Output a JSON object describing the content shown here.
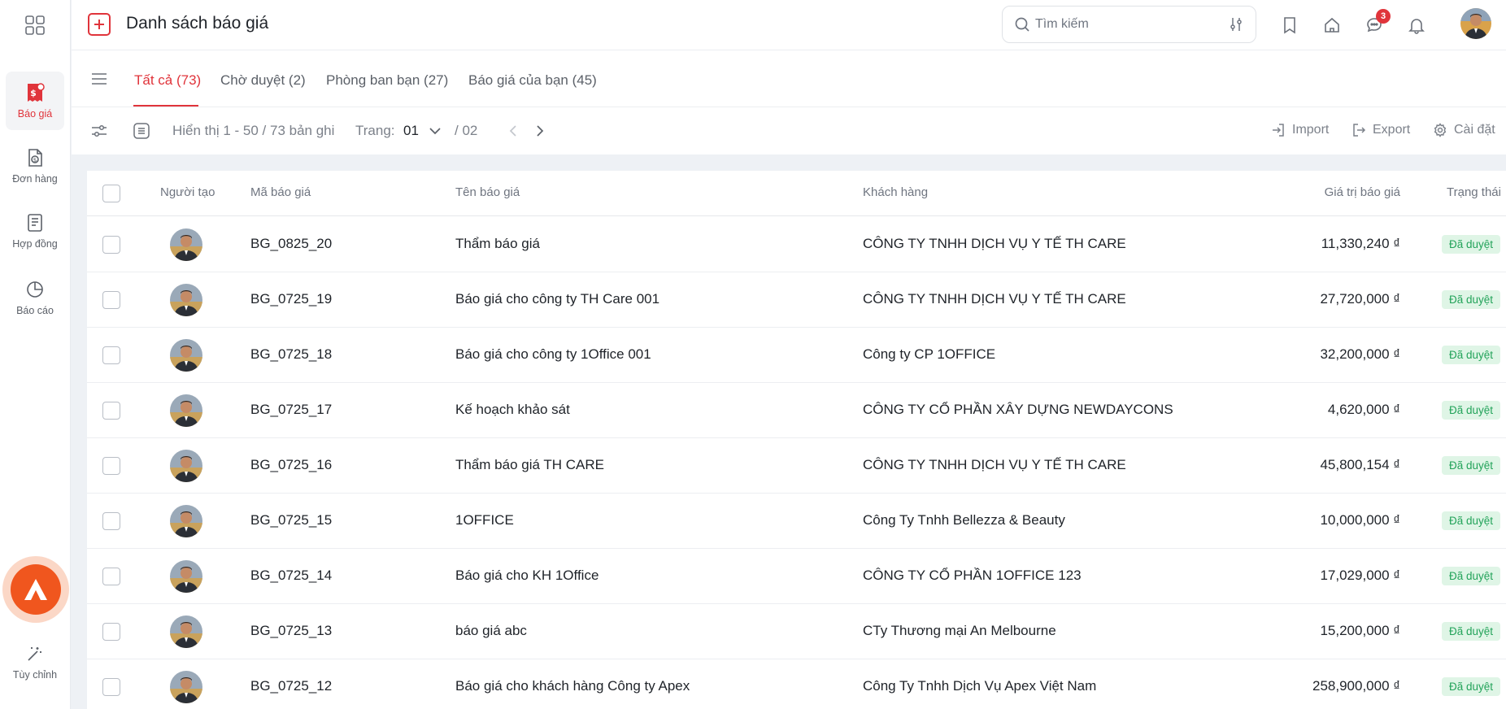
{
  "header": {
    "title": "Danh sách báo giá",
    "search_placeholder": "Tìm kiếm",
    "chat_badge": "3"
  },
  "sidebar": {
    "items": [
      {
        "label": "Báo giá",
        "icon": "quote-icon",
        "active": true
      },
      {
        "label": "Đơn hàng",
        "icon": "order-icon",
        "active": false
      },
      {
        "label": "Hợp đồng",
        "icon": "contract-icon",
        "active": false
      },
      {
        "label": "Báo cáo",
        "icon": "pie-chart-icon",
        "active": false
      }
    ],
    "customize_label": "Tùy chỉnh"
  },
  "tabs": [
    {
      "label": "Tất cả (73)",
      "active": true
    },
    {
      "label": "Chờ duyệt (2)",
      "active": false
    },
    {
      "label": "Phòng ban bạn (27)",
      "active": false
    },
    {
      "label": "Báo giá của bạn (45)",
      "active": false
    }
  ],
  "toolbar": {
    "display_text": "Hiển thị 1 - 50 / 73 bản ghi",
    "page_label": "Trang:",
    "page_current": "01",
    "page_total": "/ 02",
    "import_label": "Import",
    "export_label": "Export",
    "settings_label": "Cài đặt"
  },
  "table": {
    "columns": {
      "creator": "Người tạo",
      "code": "Mã báo giá",
      "name": "Tên báo giá",
      "customer": "Khách hàng",
      "value": "Giá trị báo giá",
      "status": "Trạng thái"
    },
    "rows": [
      {
        "code": "BG_0825_20",
        "name": "Thẩm báo giá",
        "customer": "CÔNG TY TNHH DỊCH VỤ Y TẾ TH CARE",
        "value": "11,330,240 ₫",
        "status": "Đã duyệt"
      },
      {
        "code": "BG_0725_19",
        "name": "Báo giá cho công ty TH Care 001",
        "customer": "CÔNG TY TNHH DỊCH VỤ Y TẾ TH CARE",
        "value": "27,720,000 ₫",
        "status": "Đã duyệt"
      },
      {
        "code": "BG_0725_18",
        "name": "Báo giá cho công ty 1Office 001",
        "customer": "Công ty CP 1OFFICE",
        "value": "32,200,000 ₫",
        "status": "Đã duyệt"
      },
      {
        "code": "BG_0725_17",
        "name": "Kế hoạch khảo sát",
        "customer": "CÔNG TY CỔ PHẦN XÂY DỰNG NEWDAYCONS",
        "value": "4,620,000 ₫",
        "status": "Đã duyệt"
      },
      {
        "code": "BG_0725_16",
        "name": "Thẩm báo giá TH CARE",
        "customer": "CÔNG TY TNHH DỊCH VỤ Y TẾ TH CARE",
        "value": "45,800,154 ₫",
        "status": "Đã duyệt"
      },
      {
        "code": "BG_0725_15",
        "name": "1OFFICE",
        "customer": "Công Ty Tnhh Bellezza & Beauty",
        "value": "10,000,000 ₫",
        "status": "Đã duyệt"
      },
      {
        "code": "BG_0725_14",
        "name": "Báo giá cho KH 1Office",
        "customer": "CÔNG TY CỔ PHẦN 1OFFICE 123",
        "value": "17,029,000 ₫",
        "status": "Đã duyệt"
      },
      {
        "code": "BG_0725_13",
        "name": "báo giá abc",
        "customer": "CTy Thương mại An Melbourne",
        "value": "15,200,000 ₫",
        "status": "Đã duyệt"
      },
      {
        "code": "BG_0725_12",
        "name": "Báo giá cho khách hàng Công ty Apex",
        "customer": "Công Ty Tnhh Dịch Vụ Apex Việt Nam",
        "value": "258,900,000 ₫",
        "status": "Đã duyệt"
      }
    ]
  },
  "colors": {
    "accent": "#e0343b",
    "status_bg": "#dff5e6",
    "status_fg": "#23a35a",
    "brand": "#f0561e"
  }
}
